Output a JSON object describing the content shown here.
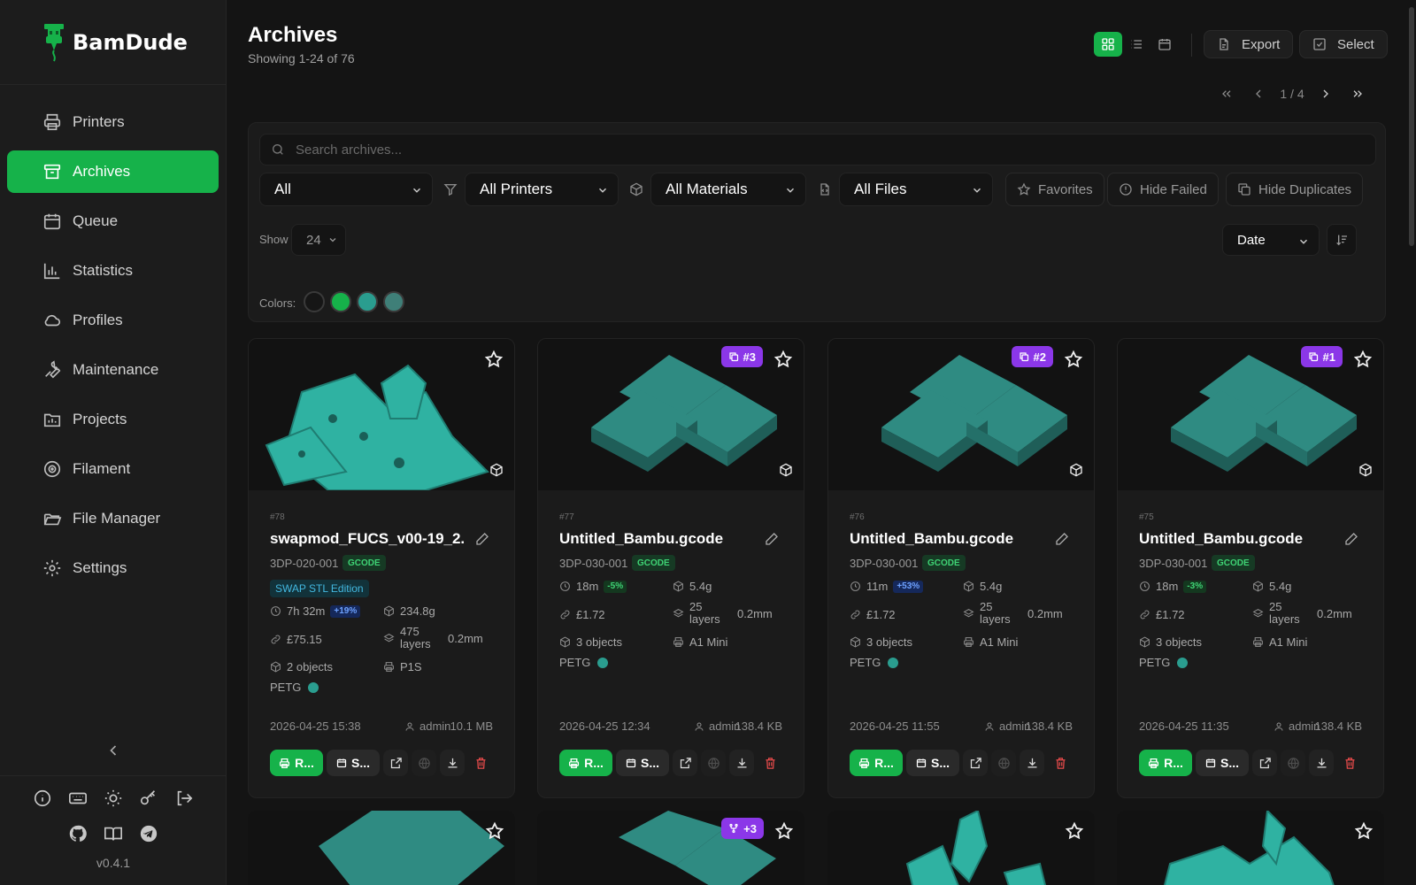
{
  "app": {
    "name": "BamDude",
    "version": "v0.4.1"
  },
  "sidebar": {
    "items": [
      {
        "label": "Printers",
        "icon": "printer-icon",
        "active": false
      },
      {
        "label": "Archives",
        "icon": "archive-icon",
        "active": true
      },
      {
        "label": "Queue",
        "icon": "calendar-icon",
        "active": false
      },
      {
        "label": "Statistics",
        "icon": "bar-chart-icon",
        "active": false
      },
      {
        "label": "Profiles",
        "icon": "cloud-icon",
        "active": false
      },
      {
        "label": "Maintenance",
        "icon": "wrench-icon",
        "active": false
      },
      {
        "label": "Projects",
        "icon": "folder-chart-icon",
        "active": false
      },
      {
        "label": "Filament",
        "icon": "spool-icon",
        "active": false
      },
      {
        "label": "File Manager",
        "icon": "folder-open-icon",
        "active": false
      },
      {
        "label": "Settings",
        "icon": "gear-icon",
        "active": false
      }
    ]
  },
  "header": {
    "title": "Archives",
    "subtitle": "Showing 1-24 of 76",
    "export_label": "Export",
    "select_label": "Select",
    "page_indicator": "1 / 4"
  },
  "filters": {
    "search_placeholder": "Search archives...",
    "status": "All",
    "printers": "All Printers",
    "materials": "All Materials",
    "files": "All Files",
    "favorites": "Favorites",
    "hide_failed": "Hide Failed",
    "hide_duplicates": "Hide Duplicates",
    "show_label": "Show",
    "show_value": "24",
    "sort_value": "Date",
    "colors_label": "Colors:",
    "colors": [
      "#161616",
      "#16b24a",
      "#2a9d8f",
      "#3f7f78"
    ]
  },
  "cards": [
    {
      "number": "#78",
      "name": "swapmod_FUCS_v00-19_2...",
      "printer_id": "3DP-020-001",
      "file_type": "GCODE",
      "tag": "SWAP STL Edition",
      "duplicate": "",
      "time": "7h 32m",
      "time_delta": "+19%",
      "time_delta_color": "blue",
      "weight": "234.8g",
      "cost": "£75.15",
      "layers": "475 layers",
      "layer_height": "0.2mm",
      "objects": "2 objects",
      "printer_model": "P1S",
      "material": "PETG",
      "date": "2026-04-25 15:38",
      "user": "admin",
      "size": "10.1 MB",
      "print_label": "R...",
      "schedule_label": "S..."
    },
    {
      "number": "#77",
      "name": "Untitled_Bambu.gcode",
      "printer_id": "3DP-030-001",
      "file_type": "GCODE",
      "tag": "",
      "duplicate": "#3",
      "time": "18m",
      "time_delta": "-5%",
      "time_delta_color": "green",
      "weight": "5.4g",
      "cost": "£1.72",
      "layers": "25 layers",
      "layer_height": "0.2mm",
      "objects": "3 objects",
      "printer_model": "A1 Mini",
      "material": "PETG",
      "date": "2026-04-25 12:34",
      "user": "admin",
      "size": "138.4 KB",
      "print_label": "R...",
      "schedule_label": "S..."
    },
    {
      "number": "#76",
      "name": "Untitled_Bambu.gcode",
      "printer_id": "3DP-030-001",
      "file_type": "GCODE",
      "tag": "",
      "duplicate": "#2",
      "time": "11m",
      "time_delta": "+53%",
      "time_delta_color": "blue",
      "weight": "5.4g",
      "cost": "£1.72",
      "layers": "25 layers",
      "layer_height": "0.2mm",
      "objects": "3 objects",
      "printer_model": "A1 Mini",
      "material": "PETG",
      "date": "2026-04-25 11:55",
      "user": "admin",
      "size": "138.4 KB",
      "print_label": "R...",
      "schedule_label": "S..."
    },
    {
      "number": "#75",
      "name": "Untitled_Bambu.gcode",
      "printer_id": "3DP-030-001",
      "file_type": "GCODE",
      "tag": "",
      "duplicate": "#1",
      "time": "18m",
      "time_delta": "-3%",
      "time_delta_color": "green",
      "weight": "5.4g",
      "cost": "£1.72",
      "layers": "25 layers",
      "layer_height": "0.2mm",
      "objects": "3 objects",
      "printer_model": "A1 Mini",
      "material": "PETG",
      "date": "2026-04-25 11:35",
      "user": "admin",
      "size": "138.4 KB",
      "print_label": "R...",
      "schedule_label": "S..."
    }
  ],
  "row2": [
    {
      "badge": ""
    },
    {
      "badge": "+3"
    },
    {
      "badge": ""
    },
    {
      "badge": ""
    }
  ],
  "colors": {
    "accent": "#16b24a",
    "duplicate_badge": "#8b37e8",
    "model": "#2a9d8f",
    "danger": "#e84b4b"
  }
}
